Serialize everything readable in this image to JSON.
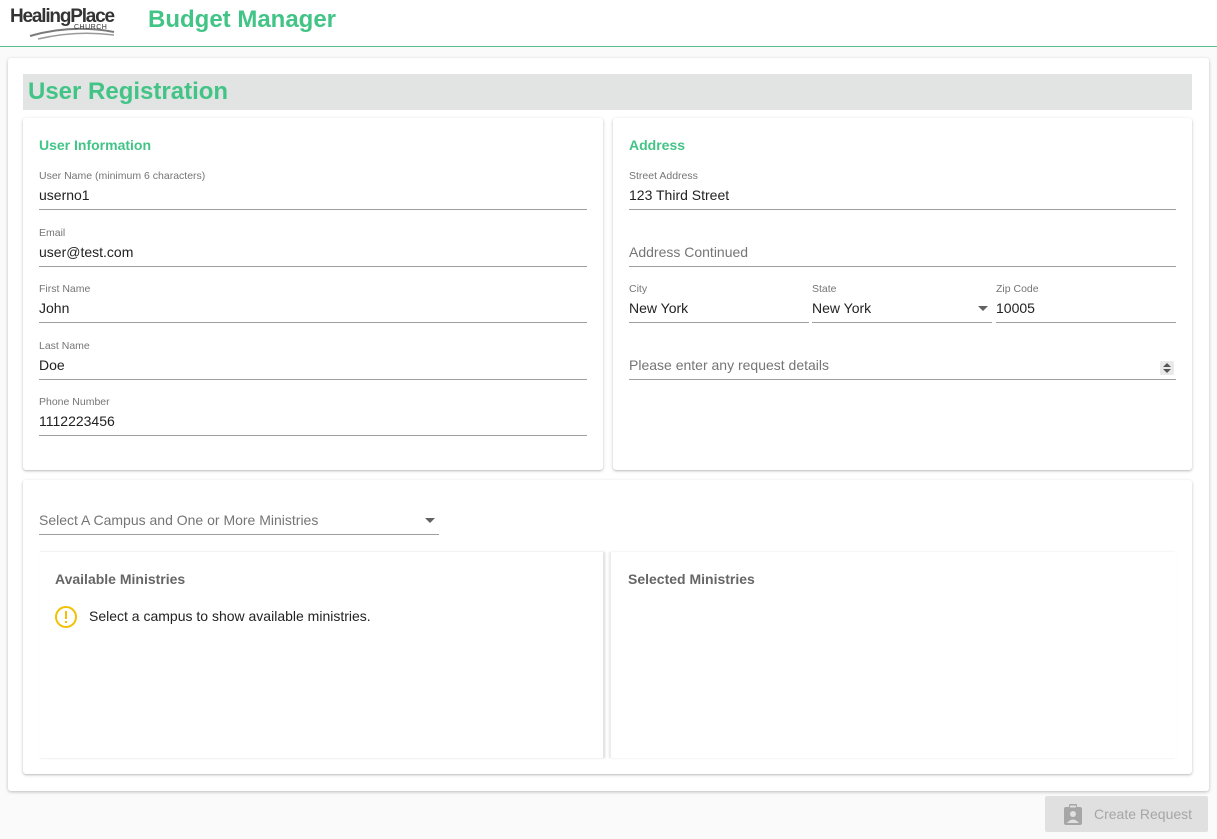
{
  "header": {
    "logo_main": "HealingPlace",
    "logo_sub": "CHURCH",
    "app_title": "Budget Manager"
  },
  "page": {
    "title": "User Registration"
  },
  "user_info": {
    "section_title": "User Information",
    "username": {
      "label": "User Name (minimum 6 characters)",
      "value": "userno1"
    },
    "email": {
      "label": "Email",
      "value": "user@test.com"
    },
    "first_name": {
      "label": "First Name",
      "value": "John"
    },
    "last_name": {
      "label": "Last Name",
      "value": "Doe"
    },
    "phone": {
      "label": "Phone Number",
      "value": "1112223456"
    }
  },
  "address": {
    "section_title": "Address",
    "street": {
      "label": "Street Address",
      "value": "123 Third Street"
    },
    "address2": {
      "placeholder": "Address Continued"
    },
    "city": {
      "label": "City",
      "value": "New York"
    },
    "state": {
      "label": "State",
      "value": "New York"
    },
    "zip": {
      "label": "Zip Code",
      "value": "10005"
    },
    "details": {
      "placeholder": "Please enter any request details"
    }
  },
  "ministries": {
    "campus_select_placeholder": "Select A Campus and One or More Ministries",
    "available_title": "Available Ministries",
    "warning_text": "Select a campus to show available ministries.",
    "selected_title": "Selected Ministries"
  },
  "actions": {
    "create_label": "Create Request"
  },
  "colors": {
    "brand_green": "#43c487",
    "header_bg": "#e2e3e3",
    "warning": "#f2c000",
    "disabled_bg": "#e0e0e0",
    "disabled_text": "#a6a6a6"
  },
  "icons": {
    "warning": "warning-circle-icon",
    "create": "clipboard-account-icon",
    "dropdown": "chevron-down-icon"
  }
}
